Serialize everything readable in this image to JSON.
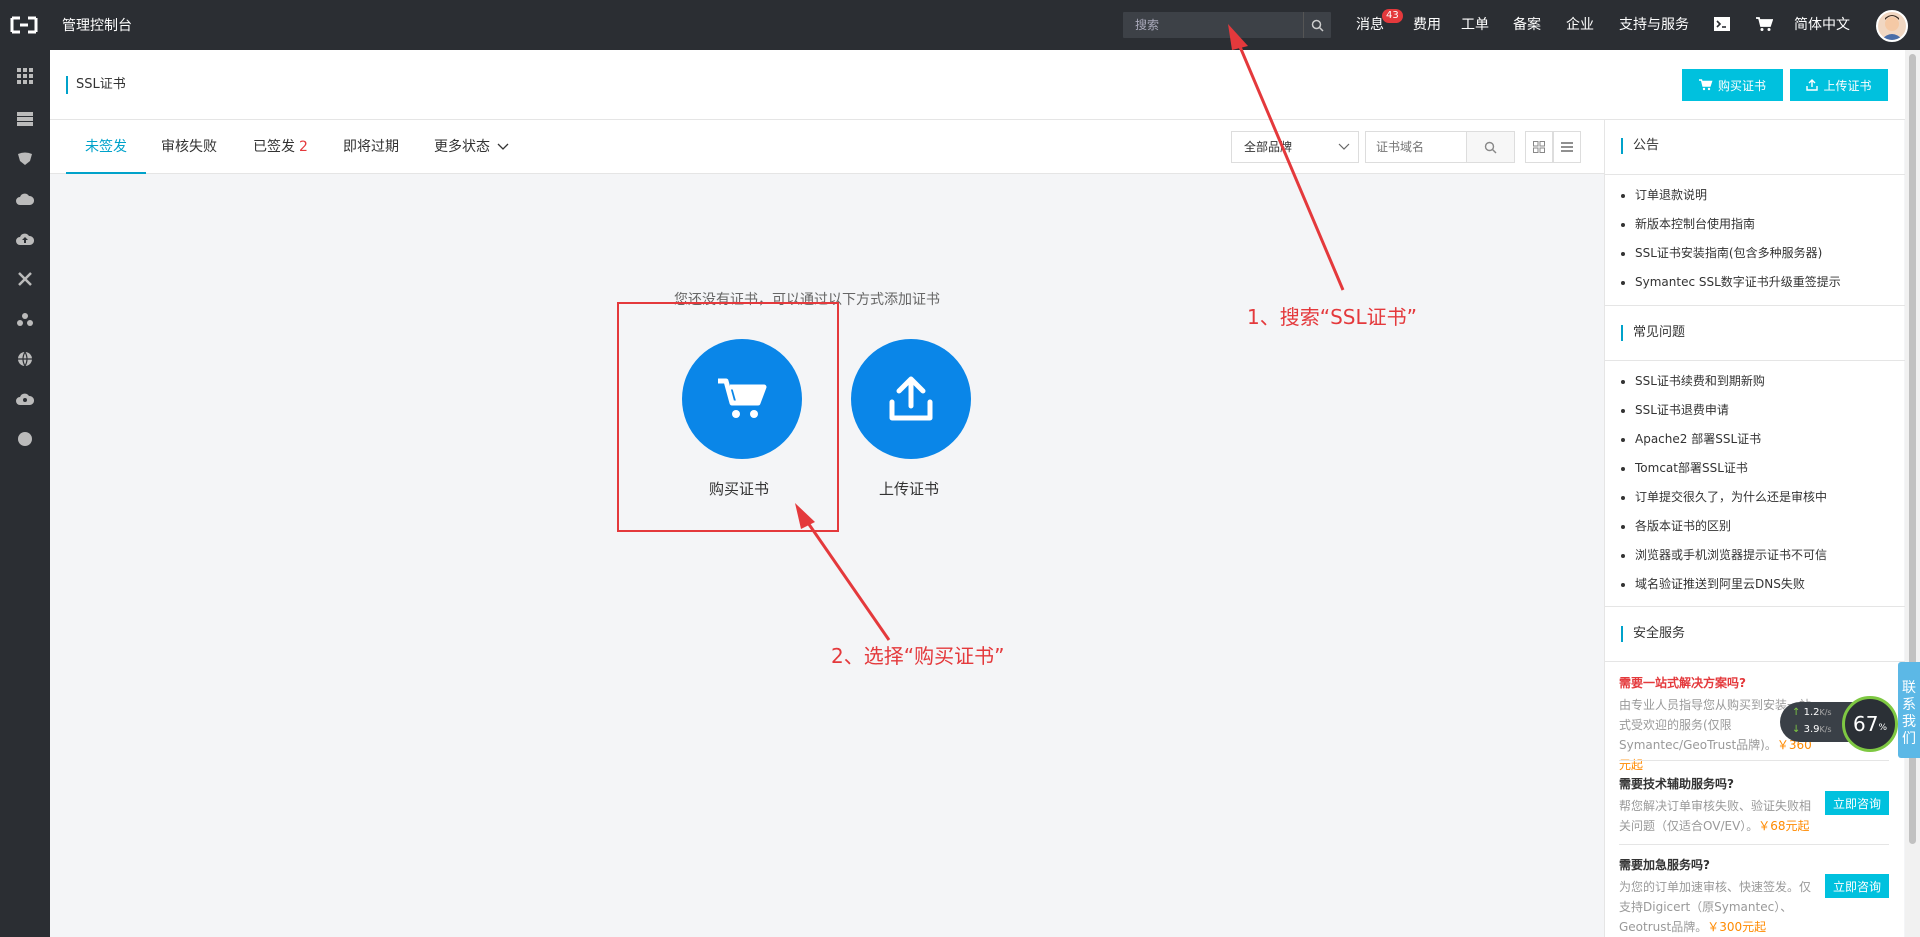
{
  "topbar": {
    "console_title": "管理控制台",
    "search_placeholder": "搜索",
    "nav": {
      "messages": "消息",
      "messages_badge": "43",
      "fees": "费用",
      "tickets": "工单",
      "icp": "备案",
      "enterprise": "企业",
      "support": "支持与服务",
      "language": "简体中文"
    }
  },
  "header": {
    "title": "SSL证书",
    "buy_button": "购买证书",
    "upload_button": "上传证书"
  },
  "tabs": [
    {
      "label": "未签发",
      "count": ""
    },
    {
      "label": "审核失败",
      "count": ""
    },
    {
      "label": "已签发",
      "count": "2"
    },
    {
      "label": "即将过期",
      "count": ""
    },
    {
      "label": "更多状态",
      "count": ""
    }
  ],
  "filters": {
    "brand_select": "全部品牌",
    "domain_placeholder": "证书域名"
  },
  "empty": {
    "hint": "您还没有证书，可以通过以下方式添加证书",
    "buy_label": "购买证书",
    "upload_label": "上传证书"
  },
  "annotations": {
    "step1": "1、搜索“SSL证书”",
    "step2": "2、选择“购买证书”",
    "color": "#e4393c"
  },
  "rightpanel": {
    "notice_title": "公告",
    "notices": [
      "订单退款说明",
      "新版本控制台使用指南",
      "SSL证书安装指南(包含多种服务器)",
      "Symantec SSL数字证书升级重签提示"
    ],
    "faq_title": "常见问题",
    "faqs": [
      "SSL证书续费和到期新购",
      "SSL证书退费申请",
      "Apache2 部署SSL证书",
      "Tomcat部署SSL证书",
      "订单提交很久了，为什么还是审核中",
      "各版本证书的区别",
      "浏览器或手机浏览器提示证书不可信",
      "域名验证推送到阿里云DNS失败"
    ],
    "security_title": "安全服务",
    "services": [
      {
        "title": "需要一站式解决方案吗?",
        "desc": "由专业人员指导您从购买到安装一站式受欢迎的服务(仅限Symantec/GeoTrust品牌)。",
        "price": "￥360元起",
        "button": ""
      },
      {
        "title": "需要技术辅助服务吗?",
        "desc": "帮您解决订单审核失败、验证失败相关问题（仅适合OV/EV）。",
        "price": "￥68元起",
        "button": "立即咨询"
      },
      {
        "title": "需要加急服务吗?",
        "desc": "为您的订单加速审核、快速签发。仅支持Digicert（原Symantec）、Geotrust品牌。",
        "price": "￥300元起",
        "button": "立即咨询"
      }
    ]
  },
  "widgets": {
    "contact": "联系我们",
    "upload_speed": "1.2",
    "download_speed": "3.9",
    "speed_unit": "K/s",
    "percent": "67",
    "percent_unit": "%"
  },
  "colors": {
    "accent": "#00c1de",
    "primary_blue": "#0a86e8",
    "topbar": "#2b2e33",
    "annotation_red": "#e4393c"
  }
}
